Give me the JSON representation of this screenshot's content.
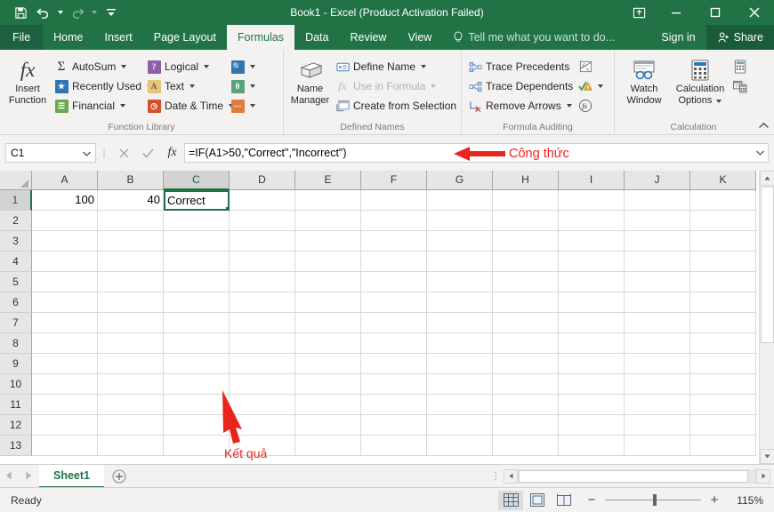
{
  "titlebar": {
    "title": "Book1 - Excel (Product Activation Failed)",
    "qat": [
      {
        "name": "save-icon",
        "label": "Save"
      },
      {
        "name": "undo-icon",
        "label": "Undo"
      },
      {
        "name": "redo-icon",
        "label": "Redo"
      },
      {
        "name": "customize-qat-icon",
        "label": "Customize Quick Access Toolbar"
      }
    ],
    "window_controls": [
      {
        "name": "ribbon-display-options-button",
        "label": "Ribbon Display Options"
      },
      {
        "name": "minimize-button",
        "label": "Minimize"
      },
      {
        "name": "maximize-button",
        "label": "Maximize"
      },
      {
        "name": "close-button",
        "label": "Close"
      }
    ]
  },
  "ribbon_tabs": {
    "file": "File",
    "tabs": [
      {
        "label": "Home",
        "active": false
      },
      {
        "label": "Insert",
        "active": false
      },
      {
        "label": "Page Layout",
        "active": false
      },
      {
        "label": "Formulas",
        "active": true
      },
      {
        "label": "Data",
        "active": false
      },
      {
        "label": "Review",
        "active": false
      },
      {
        "label": "View",
        "active": false
      }
    ],
    "tellme": "Tell me what you want to do...",
    "signin": "Sign in",
    "share": "Share"
  },
  "ribbon": {
    "groups": [
      {
        "label": "Function Library",
        "big": {
          "label_line1": "Insert",
          "label_line2": "Function",
          "icon": "fx-icon"
        },
        "items": [
          {
            "label": "AutoSum",
            "icon": "sigma-icon",
            "caret": true,
            "disabled": false
          },
          {
            "label": "Recently Used",
            "icon": "recently-used-icon",
            "caret": true,
            "disabled": false
          },
          {
            "label": "Financial",
            "icon": "financial-icon",
            "caret": true,
            "disabled": false
          },
          {
            "label": "Logical",
            "icon": "logical-icon",
            "caret": true,
            "disabled": false
          },
          {
            "label": "Text",
            "icon": "text-icon",
            "caret": true,
            "disabled": false
          },
          {
            "label": "Date & Time",
            "icon": "date-time-icon",
            "caret": true,
            "disabled": false
          },
          {
            "label": "",
            "icon": "lookup-reference-icon",
            "caret": true,
            "disabled": false
          },
          {
            "label": "",
            "icon": "math-trig-icon",
            "caret": true,
            "disabled": false
          },
          {
            "label": "",
            "icon": "more-functions-icon",
            "caret": true,
            "disabled": false
          }
        ]
      },
      {
        "label": "Defined Names",
        "big": {
          "label_line1": "Name",
          "label_line2": "Manager",
          "icon": "name-manager-icon"
        },
        "items": [
          {
            "label": "Define Name",
            "icon": "define-name-icon",
            "caret": true,
            "disabled": false
          },
          {
            "label": "Use in Formula",
            "icon": "use-in-formula-icon",
            "caret": true,
            "disabled": true
          },
          {
            "label": "Create from Selection",
            "icon": "create-from-selection-icon",
            "caret": false,
            "disabled": false
          }
        ]
      },
      {
        "label": "Formula Auditing",
        "items": [
          {
            "label": "Trace Precedents",
            "icon": "trace-precedents-icon",
            "caret": false,
            "disabled": false
          },
          {
            "label": "Trace Dependents",
            "icon": "trace-dependents-icon",
            "caret": false,
            "disabled": false
          },
          {
            "label": "Remove Arrows",
            "icon": "remove-arrows-icon",
            "caret": true,
            "disabled": false
          },
          {
            "label": "",
            "icon": "show-formulas-icon",
            "caret": false,
            "disabled": false
          },
          {
            "label": "",
            "icon": "error-checking-icon",
            "caret": true,
            "disabled": false
          },
          {
            "label": "",
            "icon": "evaluate-formula-icon",
            "caret": false,
            "disabled": false
          }
        ]
      },
      {
        "label": "Calculation",
        "big": {
          "label_line1": "Watch",
          "label_line2": "Window",
          "icon": "watch-window-icon"
        },
        "big2": {
          "label_line1": "Calculation",
          "label_line2": "Options",
          "icon": "calculation-options-icon",
          "caret": true
        },
        "items": [
          {
            "label": "",
            "icon": "calculate-now-icon",
            "caret": false,
            "disabled": false
          },
          {
            "label": "",
            "icon": "calculate-sheet-icon",
            "caret": false,
            "disabled": false
          }
        ]
      }
    ],
    "collapse": "collapse-ribbon-icon"
  },
  "formula_bar": {
    "name_box_value": "C1",
    "cancel_label": "Cancel",
    "enter_label": "Enter",
    "insert_function_label": "fx",
    "formula": "=IF(A1>50,\"Correct\",\"Incorrect\")",
    "expand_label": "Expand Formula Bar"
  },
  "annotations": {
    "formula_note": "Công thức",
    "result_note": "Kết quả",
    "color": "#e8251c"
  },
  "grid": {
    "columns": [
      "A",
      "B",
      "C",
      "D",
      "E",
      "F",
      "G",
      "H",
      "I",
      "J",
      "K"
    ],
    "selected_column": "C",
    "rows": [
      "1",
      "2",
      "3",
      "4",
      "5",
      "6",
      "7",
      "8",
      "9",
      "10",
      "11",
      "12",
      "13"
    ],
    "selected_row": "1",
    "cells": {
      "A1": {
        "value": "100",
        "align": "num"
      },
      "B1": {
        "value": "40",
        "align": "num"
      },
      "C1": {
        "value": "Correct",
        "align": "text",
        "selected": true
      }
    }
  },
  "sheet_tabs": {
    "prev_label": "Previous Sheet",
    "next_label": "Next Sheet",
    "sheets": [
      {
        "label": "Sheet1",
        "active": true
      }
    ],
    "add_label": "New sheet"
  },
  "statusbar": {
    "status": "Ready",
    "views": [
      {
        "name": "normal-view-button",
        "label": "Normal",
        "active": true
      },
      {
        "name": "page-layout-view-button",
        "label": "Page Layout",
        "active": false
      },
      {
        "name": "page-break-preview-button",
        "label": "Page Break Preview",
        "active": false
      }
    ],
    "zoom_out": "−",
    "zoom_in": "+",
    "zoom_level": "115%"
  }
}
